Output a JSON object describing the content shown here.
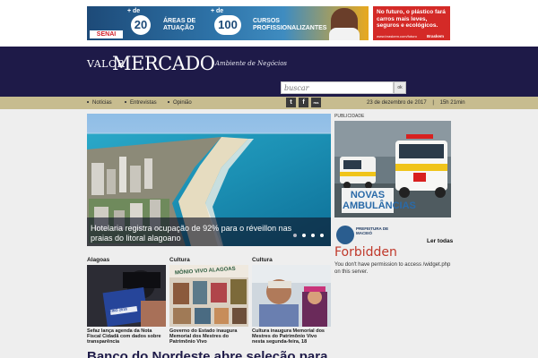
{
  "ads": {
    "senai": {
      "brand": "SENAI",
      "plus1": "+ de",
      "num1": "20",
      "label1": "ÁREAS DE ATUAÇÃO",
      "plus2": "+ de",
      "num2": "100",
      "label2": "CURSOS PROFISSIONALIZANTES"
    },
    "plastic": {
      "text": "No futuro, o plástico fará carros mais leves, seguros e ecológicos.",
      "url": "www.braskem.com/futuro",
      "brand": "Braskem"
    }
  },
  "header": {
    "brand_valor": "VALOR",
    "brand_mercado": "MERCADO",
    "tagline": "Ambiente de Negócios",
    "search_placeholder": "buscar",
    "search_button": "ok"
  },
  "nav": {
    "items": [
      "Notícias",
      "Entrevistas",
      "Opinião"
    ],
    "social": [
      "t",
      "f",
      "rss"
    ],
    "date": "23 de dezembro de 2017",
    "separator": "|",
    "time": "15h 21min"
  },
  "hero": {
    "title": "Hotelaria registra ocupação de 92% para o réveillon nas praias do litoral alagoano",
    "slides": 4,
    "active_slide": 1
  },
  "sidebar": {
    "pub_label": "PUBLICIDADE",
    "ad_text": "NOVAS AMBULÂNCIAS",
    "maceio_label": "PREFEITURA DE MACEIÓ",
    "ler_todas": "Ler todas",
    "forbidden_title": "Forbidden",
    "forbidden_msg": "You don't have permission to access /widget.php on this server."
  },
  "cards": [
    {
      "category": "Alagoas",
      "text": "Sefaz lança agenda da Nota Fiscal Cidadã com dados sobre transparência",
      "img_text": "REINO 2018"
    },
    {
      "category": "Cultura",
      "text": "Governo do Estado inaugura Memorial dos Mestres do Patrimônio Vivo",
      "img_text": "MÔNIO VIVO ALAGOAS"
    },
    {
      "category": "Cultura",
      "text": "Cultura inaugura Memorial dos Mestres do Patrimônio Vivo nesta segunda-feira, 18"
    }
  ],
  "headline_peek": "Banco do Nordeste abre seleção para",
  "colors": {
    "header_bg": "#1e1a48",
    "nav_bg": "#c7bc8f",
    "forbidden": "#c0392b",
    "plastic_ad": "#d42a27"
  }
}
